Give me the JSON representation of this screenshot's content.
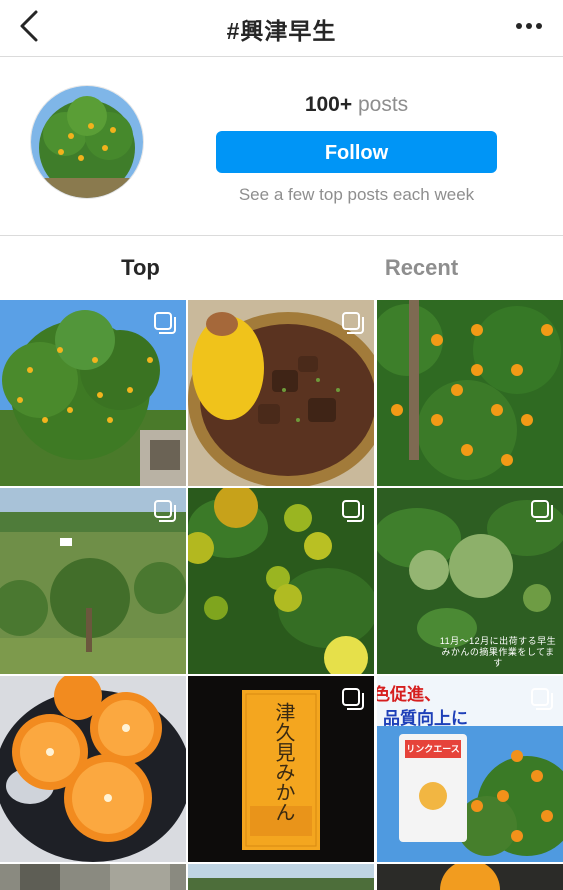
{
  "header": {
    "title": "#興津早生",
    "back_icon": "chevron-left-icon",
    "more_icon": "more-horizontal-icon"
  },
  "profile": {
    "post_count": "100+",
    "post_label": "posts",
    "follow_label": "Follow",
    "subtitle": "See a few top posts each week"
  },
  "tabs": [
    {
      "label": "Top",
      "active": true
    },
    {
      "label": "Recent",
      "active": false
    }
  ],
  "posts": [
    {
      "id": 1,
      "multi": true
    },
    {
      "id": 2,
      "multi": true
    },
    {
      "id": 3,
      "multi": false
    },
    {
      "id": 4,
      "multi": true
    },
    {
      "id": 5,
      "multi": true
    },
    {
      "id": 6,
      "multi": true,
      "overlay_text": "11月〜12月に出荷する早生みかんの摘果作業をしてます"
    },
    {
      "id": 7,
      "multi": false
    },
    {
      "id": 8,
      "multi": true,
      "box_text": "津久見みかん"
    },
    {
      "id": 9,
      "multi": true,
      "banner_text_1": "色促進、",
      "banner_text_2": "品質向上に",
      "bag_text": "リンクエース"
    }
  ],
  "colors": {
    "accent": "#0095f6",
    "text": "#262626",
    "muted": "#8e8e8e"
  }
}
